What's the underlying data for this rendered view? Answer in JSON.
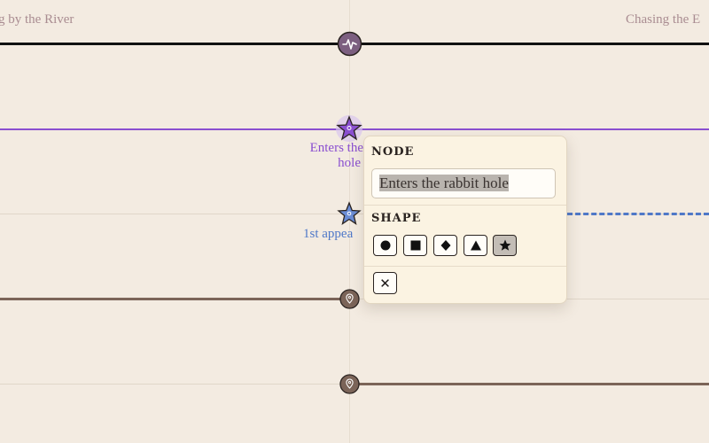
{
  "chapters": {
    "left": "g by the River",
    "right": "Chasing the E"
  },
  "nodes": {
    "n1": {
      "label_line1": "Enters the",
      "label_line2": "hole",
      "color": "#8a4fd0"
    },
    "n2": {
      "label": "1st appea",
      "color": "#4f78c8"
    }
  },
  "popover": {
    "node_heading": "NODE",
    "input_value": "Enters the rabbit hole",
    "shape_heading": "SHAPE",
    "shapes": [
      "circle",
      "square",
      "diamond",
      "triangle",
      "star"
    ],
    "selected_shape": "star",
    "close_label": "✕"
  },
  "colors": {
    "background": "#f3ebe1",
    "main_track": "#111111",
    "purple_track": "#8a4fd0",
    "blue_dashed_track": "#4f78c8",
    "brown_track": "#7b6458"
  }
}
